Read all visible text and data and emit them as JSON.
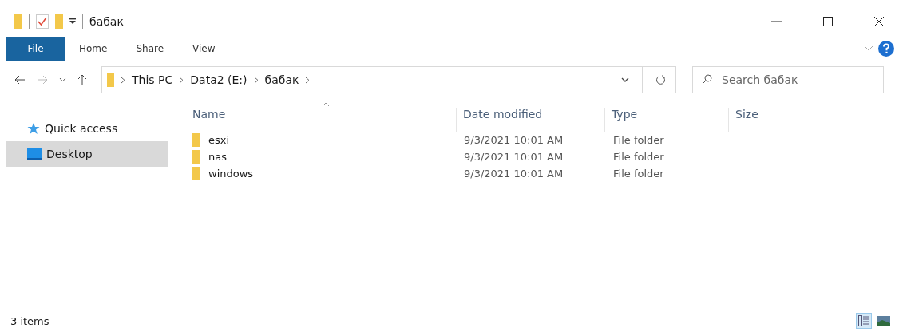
{
  "window": {
    "title": "бабак"
  },
  "ribbon_tabs": [
    {
      "label": "File",
      "kind": "file"
    },
    {
      "label": "Home",
      "kind": "tab"
    },
    {
      "label": "Share",
      "kind": "tab"
    },
    {
      "label": "View",
      "kind": "tab"
    }
  ],
  "address_bar": {
    "breadcrumbs": [
      "This PC",
      "Data2 (E:)",
      "бабак"
    ]
  },
  "search": {
    "placeholder": "Search бабак"
  },
  "sidebar": {
    "items": [
      {
        "label": "Quick access",
        "kind": "star",
        "selected": false
      },
      {
        "label": "Desktop",
        "kind": "desktop",
        "selected": true
      }
    ]
  },
  "table": {
    "columns": [
      "Name",
      "Date modified",
      "Type",
      "Size"
    ],
    "rows": [
      {
        "name": "esxi",
        "date_modified": "9/3/2021 10:01 AM",
        "type": "File folder"
      },
      {
        "name": "nas",
        "date_modified": "9/3/2021 10:01 AM",
        "type": "File folder"
      },
      {
        "name": "windows",
        "date_modified": "9/3/2021 10:01 AM",
        "type": "File folder"
      }
    ]
  },
  "status_bar": {
    "text": "3 items",
    "view_buttons": [
      {
        "kind": "details",
        "selected": true
      },
      {
        "kind": "thumbnails",
        "selected": false
      }
    ]
  }
}
